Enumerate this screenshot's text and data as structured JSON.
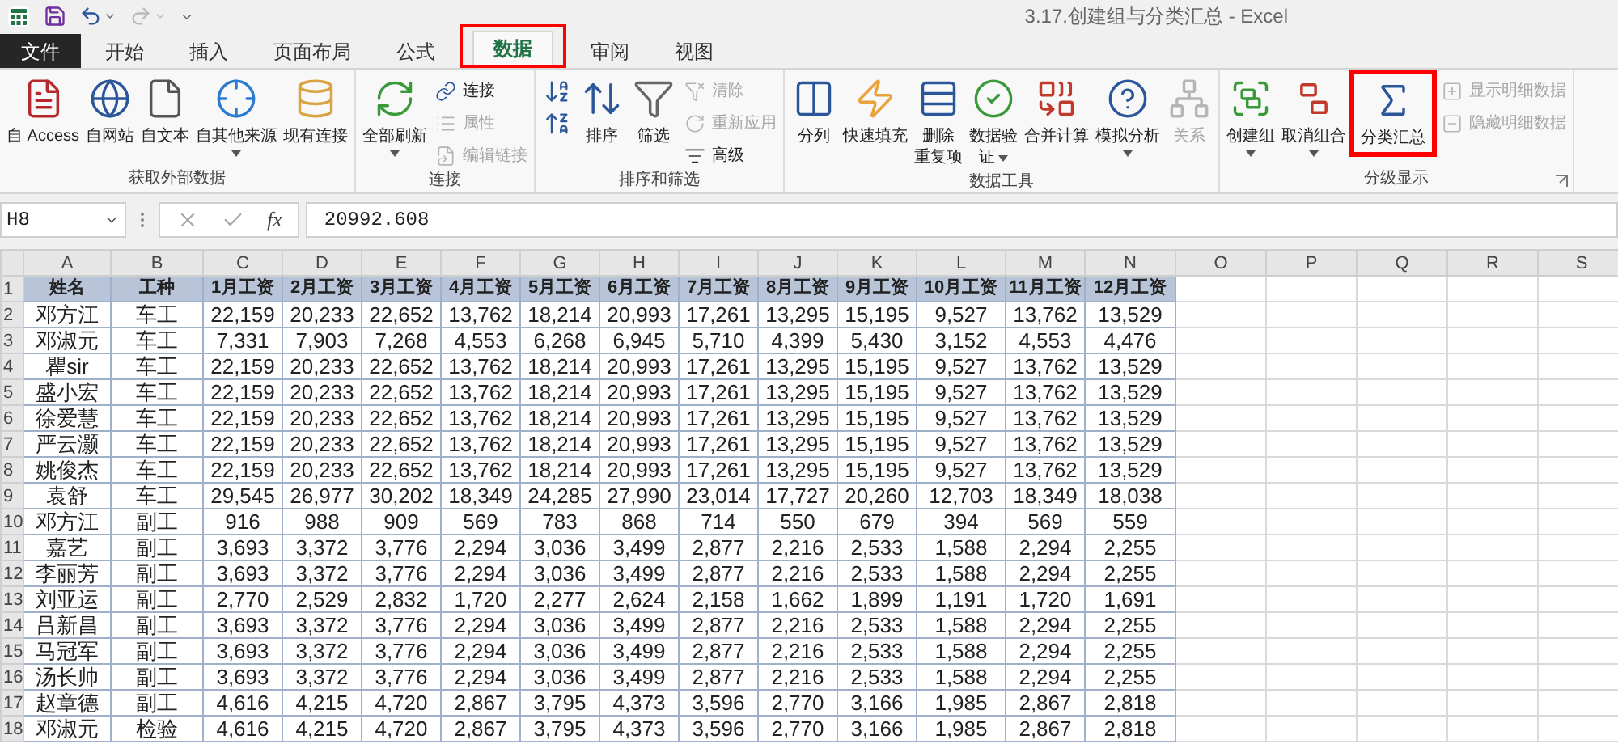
{
  "window": {
    "title": "3.17.创建组与分类汇总 - Excel"
  },
  "tabs": [
    {
      "label": "文件",
      "kind": "file",
      "selected": false,
      "highlighted": false
    },
    {
      "label": "开始",
      "kind": "tab",
      "selected": false,
      "highlighted": false
    },
    {
      "label": "插入",
      "kind": "tab",
      "selected": false,
      "highlighted": false
    },
    {
      "label": "页面布局",
      "kind": "tab",
      "selected": false,
      "highlighted": false
    },
    {
      "label": "公式",
      "kind": "tab",
      "selected": false,
      "highlighted": false
    },
    {
      "label": "数据",
      "kind": "tab",
      "selected": true,
      "highlighted": true
    },
    {
      "label": "审阅",
      "kind": "tab",
      "selected": false,
      "highlighted": false
    },
    {
      "label": "视图",
      "kind": "tab",
      "selected": false,
      "highlighted": false
    }
  ],
  "ribbon": {
    "groups": [
      {
        "label": "获取外部数据",
        "launcher": false,
        "items": [
          {
            "label": "自 Access",
            "kind": "large",
            "disabled": false,
            "dropdown": false,
            "highlighted": false
          },
          {
            "label": "自网站",
            "kind": "large",
            "disabled": false,
            "dropdown": false,
            "highlighted": false
          },
          {
            "label": "自文本",
            "kind": "large",
            "disabled": false,
            "dropdown": false,
            "highlighted": false
          },
          {
            "label": "自其他来源",
            "kind": "large",
            "disabled": false,
            "dropdown": true,
            "highlighted": false
          },
          {
            "label": "现有连接",
            "kind": "large",
            "disabled": false,
            "dropdown": false,
            "highlighted": false
          }
        ]
      },
      {
        "label": "连接",
        "launcher": false,
        "items": [
          {
            "label": "全部刷新",
            "kind": "large",
            "disabled": false,
            "dropdown": true,
            "highlighted": false
          },
          {
            "label": "连接",
            "kind": "small",
            "disabled": false
          },
          {
            "label": "属性",
            "kind": "small",
            "disabled": true
          },
          {
            "label": "编辑链接",
            "kind": "small",
            "disabled": true
          }
        ]
      },
      {
        "label": "排序和筛选",
        "launcher": false,
        "items": [
          {
            "kind": "icon",
            "disabled": false
          },
          {
            "kind": "icon",
            "disabled": false
          },
          {
            "label": "排序",
            "kind": "large",
            "disabled": false,
            "dropdown": false,
            "highlighted": false
          },
          {
            "label": "筛选",
            "kind": "large",
            "disabled": false,
            "dropdown": false,
            "highlighted": false
          },
          {
            "label": "清除",
            "kind": "small",
            "disabled": true
          },
          {
            "label": "重新应用",
            "kind": "small",
            "disabled": true
          },
          {
            "label": "高级",
            "kind": "small",
            "disabled": false
          }
        ]
      },
      {
        "label": "数据工具",
        "launcher": false,
        "items": [
          {
            "label": "分列",
            "kind": "large",
            "disabled": false,
            "dropdown": false,
            "highlighted": false
          },
          {
            "label": "快速填充",
            "kind": "large",
            "disabled": false,
            "dropdown": false,
            "highlighted": false
          },
          {
            "lines": [
              "删除",
              "重复项"
            ],
            "kind": "large",
            "disabled": false,
            "dropdown": false,
            "highlighted": false
          },
          {
            "lines": [
              "数据验",
              "证"
            ],
            "kind": "large",
            "disabled": false,
            "dropdown": true,
            "highlighted": false
          },
          {
            "label": "合并计算",
            "kind": "large",
            "disabled": false,
            "dropdown": false,
            "highlighted": false
          },
          {
            "label": "模拟分析",
            "kind": "large",
            "disabled": false,
            "dropdown": true,
            "highlighted": false
          },
          {
            "label": "关系",
            "kind": "large",
            "disabled": true,
            "dropdown": false,
            "highlighted": false
          }
        ]
      },
      {
        "label": "分级显示",
        "launcher": true,
        "items": [
          {
            "label": "创建组",
            "kind": "large",
            "disabled": false,
            "dropdown": true,
            "highlighted": false
          },
          {
            "label": "取消组合",
            "kind": "large",
            "disabled": false,
            "dropdown": true,
            "highlighted": false
          },
          {
            "label": "分类汇总",
            "kind": "large",
            "disabled": false,
            "dropdown": false,
            "highlighted": true
          },
          {
            "label": "显示明细数据",
            "kind": "small",
            "disabled": true
          },
          {
            "label": "隐藏明细数据",
            "kind": "small",
            "disabled": true
          }
        ]
      }
    ]
  },
  "formula_bar": {
    "name_box": "H8",
    "function_label": "fx",
    "value": "20992.608"
  },
  "sheet": {
    "columns": [
      "A",
      "B",
      "C",
      "D",
      "E",
      "F",
      "G",
      "H",
      "I",
      "J",
      "K",
      "L",
      "M",
      "N",
      "O",
      "P",
      "Q",
      "R",
      "S"
    ],
    "header_row": {
      "number": "1",
      "cells": [
        "姓名",
        "工种",
        "1月工资",
        "2月工资",
        "3月工资",
        "4月工资",
        "5月工资",
        "6月工资",
        "7月工资",
        "8月工资",
        "9月工资",
        "10月工资",
        "11月工资",
        "12月工资"
      ]
    },
    "rows": [
      {
        "number": "2",
        "cells": [
          "邓方江",
          "车工",
          "22,159",
          "20,233",
          "22,652",
          "13,762",
          "18,214",
          "20,993",
          "17,261",
          "13,295",
          "15,195",
          "9,527",
          "13,762",
          "13,529"
        ]
      },
      {
        "number": "3",
        "cells": [
          "邓淑元",
          "车工",
          "7,331",
          "7,903",
          "7,268",
          "4,553",
          "6,268",
          "6,945",
          "5,710",
          "4,399",
          "5,430",
          "3,152",
          "4,553",
          "4,476"
        ]
      },
      {
        "number": "4",
        "cells": [
          "瞿sir",
          "车工",
          "22,159",
          "20,233",
          "22,652",
          "13,762",
          "18,214",
          "20,993",
          "17,261",
          "13,295",
          "15,195",
          "9,527",
          "13,762",
          "13,529"
        ]
      },
      {
        "number": "5",
        "cells": [
          "盛小宏",
          "车工",
          "22,159",
          "20,233",
          "22,652",
          "13,762",
          "18,214",
          "20,993",
          "17,261",
          "13,295",
          "15,195",
          "9,527",
          "13,762",
          "13,529"
        ]
      },
      {
        "number": "6",
        "cells": [
          "徐爱慧",
          "车工",
          "22,159",
          "20,233",
          "22,652",
          "13,762",
          "18,214",
          "20,993",
          "17,261",
          "13,295",
          "15,195",
          "9,527",
          "13,762",
          "13,529"
        ]
      },
      {
        "number": "7",
        "cells": [
          "严云灏",
          "车工",
          "22,159",
          "20,233",
          "22,652",
          "13,762",
          "18,214",
          "20,993",
          "17,261",
          "13,295",
          "15,195",
          "9,527",
          "13,762",
          "13,529"
        ]
      },
      {
        "number": "8",
        "cells": [
          "姚俊杰",
          "车工",
          "22,159",
          "20,233",
          "22,652",
          "13,762",
          "18,214",
          "20,993",
          "17,261",
          "13,295",
          "15,195",
          "9,527",
          "13,762",
          "13,529"
        ]
      },
      {
        "number": "9",
        "cells": [
          "袁舒",
          "车工",
          "29,545",
          "26,977",
          "30,202",
          "18,349",
          "24,285",
          "27,990",
          "23,014",
          "17,727",
          "20,260",
          "12,703",
          "18,349",
          "18,038"
        ]
      },
      {
        "number": "10",
        "cells": [
          "邓方江",
          "副工",
          "916",
          "988",
          "909",
          "569",
          "783",
          "868",
          "714",
          "550",
          "679",
          "394",
          "569",
          "559"
        ]
      },
      {
        "number": "11",
        "cells": [
          "嘉艺",
          "副工",
          "3,693",
          "3,372",
          "3,776",
          "2,294",
          "3,036",
          "3,499",
          "2,877",
          "2,216",
          "2,533",
          "1,588",
          "2,294",
          "2,255"
        ]
      },
      {
        "number": "12",
        "cells": [
          "李丽芳",
          "副工",
          "3,693",
          "3,372",
          "3,776",
          "2,294",
          "3,036",
          "3,499",
          "2,877",
          "2,216",
          "2,533",
          "1,588",
          "2,294",
          "2,255"
        ]
      },
      {
        "number": "13",
        "cells": [
          "刘亚运",
          "副工",
          "2,770",
          "2,529",
          "2,832",
          "1,720",
          "2,277",
          "2,624",
          "2,158",
          "1,662",
          "1,899",
          "1,191",
          "1,720",
          "1,691"
        ]
      },
      {
        "number": "14",
        "cells": [
          "吕新昌",
          "副工",
          "3,693",
          "3,372",
          "3,776",
          "2,294",
          "3,036",
          "3,499",
          "2,877",
          "2,216",
          "2,533",
          "1,588",
          "2,294",
          "2,255"
        ]
      },
      {
        "number": "15",
        "cells": [
          "马冠军",
          "副工",
          "3,693",
          "3,372",
          "3,776",
          "2,294",
          "3,036",
          "3,499",
          "2,877",
          "2,216",
          "2,533",
          "1,588",
          "2,294",
          "2,255"
        ]
      },
      {
        "number": "16",
        "cells": [
          "汤长帅",
          "副工",
          "3,693",
          "3,372",
          "3,776",
          "2,294",
          "3,036",
          "3,499",
          "2,877",
          "2,216",
          "2,533",
          "1,588",
          "2,294",
          "2,255"
        ]
      },
      {
        "number": "17",
        "cells": [
          "赵章德",
          "副工",
          "4,616",
          "4,215",
          "4,720",
          "2,867",
          "3,795",
          "4,373",
          "3,596",
          "2,770",
          "3,166",
          "1,985",
          "2,867",
          "2,818"
        ]
      },
      {
        "number": "18",
        "cells": [
          "邓淑元",
          "检验",
          "4,616",
          "4,215",
          "4,720",
          "2,867",
          "3,795",
          "4,373",
          "3,596",
          "2,770",
          "3,166",
          "1,985",
          "2,867",
          "2,818"
        ]
      }
    ]
  }
}
